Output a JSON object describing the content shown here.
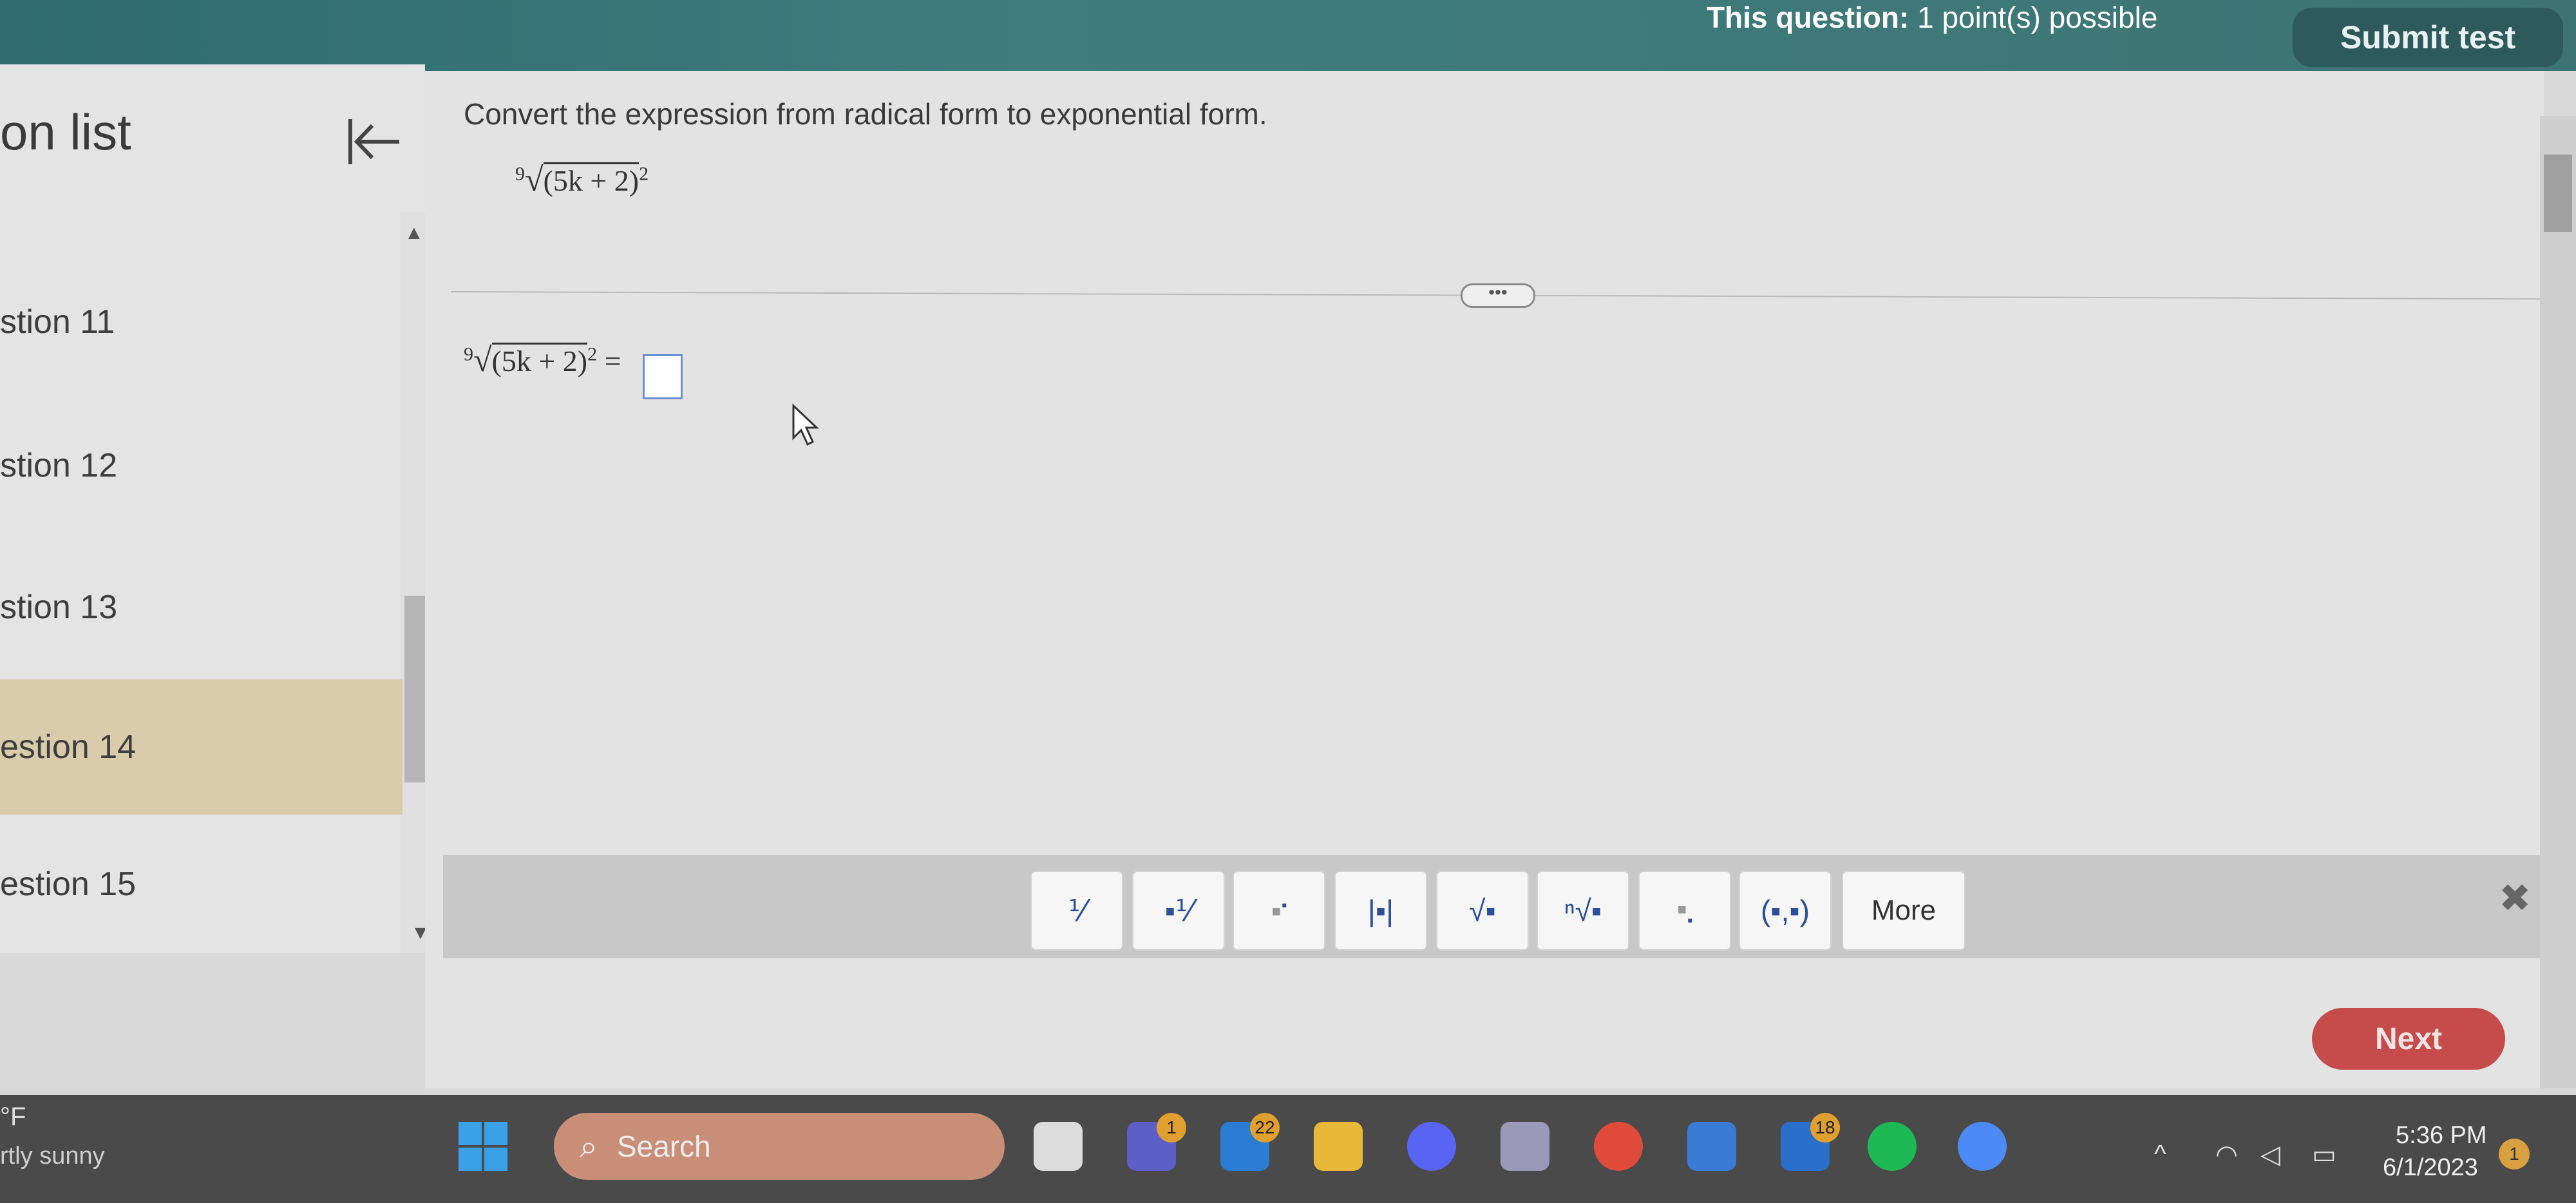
{
  "header": {
    "points_label": "This question:",
    "points_value": "1 point(s) possible",
    "submit_label": "Submit test"
  },
  "sidebar": {
    "title": "on list",
    "items": [
      {
        "label": "stion 11"
      },
      {
        "label": "stion 12"
      },
      {
        "label": "stion 13"
      },
      {
        "label": "estion 14"
      },
      {
        "label": "estion 15"
      }
    ],
    "selected_index": 3
  },
  "question": {
    "prompt": "Convert the expression from radical form to exponential form.",
    "index": "9",
    "radicand": "(5k + 2)",
    "exponent": "2",
    "equals": "="
  },
  "toolbar": {
    "buttons": [
      {
        "icon": "fraction-icon"
      },
      {
        "icon": "mixed-number-icon"
      },
      {
        "icon": "exponent-icon"
      },
      {
        "icon": "absolute-value-icon"
      },
      {
        "icon": "square-root-icon"
      },
      {
        "icon": "nth-root-icon"
      },
      {
        "icon": "subscript-icon"
      },
      {
        "icon": "ordered-pair-icon"
      }
    ],
    "more_label": "More"
  },
  "next_label": "Next",
  "taskbar": {
    "weather_temp": "°F",
    "weather_desc": "rtly sunny",
    "search_placeholder": "Search",
    "badges": {
      "teams": "1",
      "mail": "22",
      "app": "18"
    },
    "time": "5:36 PM",
    "date": "6/1/2023",
    "notifications": "1"
  },
  "colors": {
    "topbar": "#3d7473",
    "selected_item": "#d8ccaa",
    "next_button": "#c64b4b",
    "answer_border": "#6c8fcf"
  }
}
